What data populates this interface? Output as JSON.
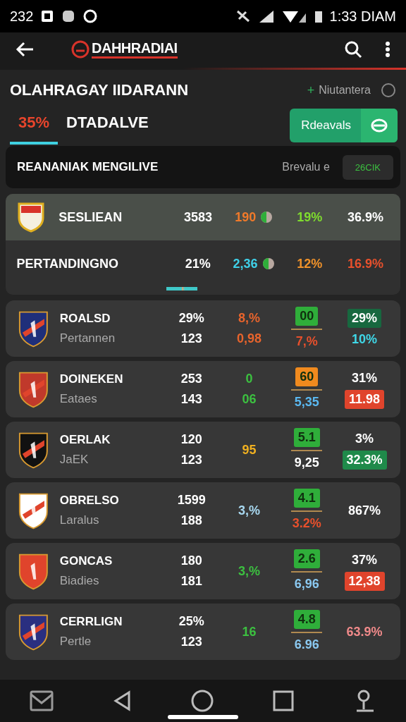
{
  "status_bar": {
    "time_left": "232",
    "time_right": "1:33 DIAM"
  },
  "app_bar": {
    "title": "DAHHRADIAI"
  },
  "heading": {
    "title": "OLAHRAGAY IIDARANN",
    "link_prefix": "+",
    "link": "Niutantera"
  },
  "tabs": [
    {
      "label": "35%",
      "selected": true
    },
    {
      "label": "DTADALVE",
      "selected": false
    }
  ],
  "action_button": {
    "label": "Rdeavals"
  },
  "section": {
    "title": "REANANIAK MENGILIVE",
    "label": "Brevalu e",
    "chip": "26CIK"
  },
  "summary_rows": [
    {
      "name": "SESLIEAN",
      "crest": true,
      "selected": true,
      "cells": [
        {
          "text": "3583",
          "color": "#ffffff"
        },
        {
          "text": "190",
          "color": "#f07a2a",
          "pie": true
        },
        {
          "text": "19%",
          "color": "#7fdc2e"
        },
        {
          "text": "36.9%",
          "color": "#ffffff"
        }
      ]
    },
    {
      "name": "PERTANDINGNO",
      "crest": false,
      "selected": false,
      "cells": [
        {
          "text": "21%",
          "color": "#ffffff"
        },
        {
          "text": "2,36",
          "color": "#3fd0e8",
          "pie": true
        },
        {
          "text": "12%",
          "color": "#f0922a"
        },
        {
          "text": "16.9%",
          "color": "#e8502c"
        }
      ]
    }
  ],
  "teams": [
    {
      "name": "ROALSD",
      "sub": "Pertannen",
      "color": "#1f2f7a",
      "c1": [
        {
          "text": "29%",
          "color": "#ffffff"
        },
        {
          "text": "123",
          "color": "#ffffff"
        }
      ],
      "c2": [
        {
          "text": "8,%",
          "color": "#e8642c"
        },
        {
          "text": "0,98",
          "color": "#e8642c"
        }
      ],
      "c3": [
        {
          "text": "00",
          "kind": "boxed",
          "color": "#2fae3a"
        },
        {
          "text": "7,%",
          "color": "#e8502c"
        }
      ],
      "c4": [
        {
          "text": "29%",
          "kind": "boxed",
          "color": "#17683f"
        },
        {
          "text": "10%",
          "color": "#3fd8e8"
        }
      ]
    },
    {
      "name": "DOINEKEN",
      "sub": "Eataes",
      "color": "#c0392b",
      "c1": [
        {
          "text": "253",
          "color": "#ffffff"
        },
        {
          "text": "143",
          "color": "#ffffff"
        }
      ],
      "c2": [
        {
          "text": "0",
          "color": "#3cc040"
        },
        {
          "text": "06",
          "color": "#3cc040"
        }
      ],
      "c3": [
        {
          "text": "60",
          "kind": "boxed",
          "color": "#f08a1e"
        },
        {
          "text": "5,35",
          "color": "#5ab8f0"
        }
      ],
      "c4": [
        {
          "text": "31%",
          "color": "#ffffff"
        },
        {
          "text": "11.98",
          "kind": "boxed",
          "color": "#e0442c"
        }
      ]
    },
    {
      "name": "OERLAK",
      "sub": "JaEK",
      "color": "#111111",
      "c1": [
        {
          "text": "120",
          "color": "#ffffff"
        },
        {
          "text": "123",
          "color": "#ffffff"
        }
      ],
      "c2": [
        {
          "text": "95",
          "color": "#f0b020"
        }
      ],
      "c3": [
        {
          "text": "5.1",
          "kind": "boxed",
          "color": "#2fae3a"
        },
        {
          "text": "9,25",
          "color": "#ffffff"
        }
      ],
      "c4": [
        {
          "text": "3%",
          "color": "#ffffff"
        },
        {
          "text": "32.3%",
          "kind": "boxed",
          "color": "#1f8a4a"
        }
      ]
    },
    {
      "name": "OBRELSO",
      "sub": "Laralus",
      "color": "#ffffff",
      "c1": [
        {
          "text": "1599",
          "color": "#ffffff"
        },
        {
          "text": "188",
          "color": "#ffffff"
        }
      ],
      "c2": [
        {
          "text": "3,%",
          "color": "#a8d8f0"
        }
      ],
      "c3": [
        {
          "text": "4.1",
          "kind": "boxed",
          "color": "#2fae3a"
        },
        {
          "text": "3.2%",
          "color": "#e8502c"
        }
      ],
      "c4": [
        {
          "text": "867%",
          "color": "#ffffff"
        }
      ]
    },
    {
      "name": "GONCAS",
      "sub": "Biadies",
      "color": "#e0442c",
      "c1": [
        {
          "text": "180",
          "color": "#ffffff"
        },
        {
          "text": "181",
          "color": "#ffffff"
        }
      ],
      "c2": [
        {
          "text": "3,%",
          "color": "#3cc040"
        }
      ],
      "c3": [
        {
          "text": "2.6",
          "kind": "boxed",
          "color": "#2fae3a"
        },
        {
          "text": "6,96",
          "color": "#8ac8f0"
        }
      ],
      "c4": [
        {
          "text": "37%",
          "color": "#ffffff"
        },
        {
          "text": "12,38",
          "kind": "boxed",
          "color": "#e0442c"
        }
      ]
    },
    {
      "name": "CERRLIGN",
      "sub": "Pertle",
      "color": "#2a2f80",
      "c1": [
        {
          "text": "25%",
          "color": "#ffffff"
        },
        {
          "text": "123",
          "color": "#ffffff"
        }
      ],
      "c2": [
        {
          "text": "16",
          "color": "#3cc040"
        }
      ],
      "c3": [
        {
          "text": "4.8",
          "kind": "boxed",
          "color": "#2fae3a"
        },
        {
          "text": "6.96",
          "color": "#8ac8f0"
        }
      ],
      "c4": [
        {
          "text": "63.9%",
          "color": "#f08a8a"
        }
      ]
    }
  ]
}
